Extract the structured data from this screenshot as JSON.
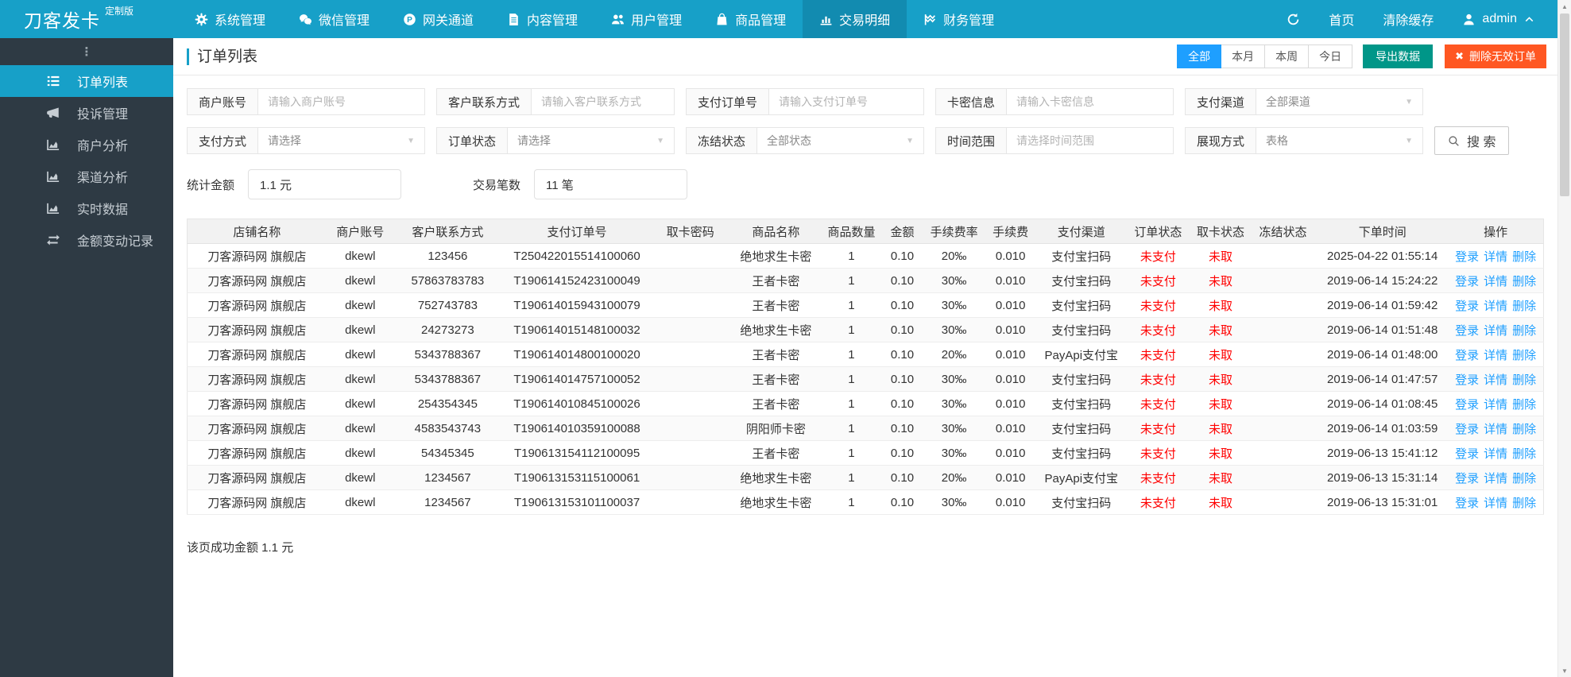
{
  "topbar": {
    "logo": "刀客发卡",
    "logo_badge": "定制版",
    "menu": [
      {
        "label": "系统管理",
        "icon": "gear-icon"
      },
      {
        "label": "微信管理",
        "icon": "wechat-icon"
      },
      {
        "label": "网关通道",
        "icon": "gateway-icon"
      },
      {
        "label": "内容管理",
        "icon": "content-icon"
      },
      {
        "label": "用户管理",
        "icon": "users-icon"
      },
      {
        "label": "商品管理",
        "icon": "goods-bag-icon"
      },
      {
        "label": "交易明细",
        "icon": "bar-chart-icon",
        "active": true
      },
      {
        "label": "财务管理",
        "icon": "finance-icon"
      }
    ],
    "right": {
      "home": "首页",
      "clear_cache": "清除缓存",
      "user": "admin"
    }
  },
  "sidebar": {
    "items": [
      {
        "label": "订单列表",
        "icon": "order-list-icon",
        "active": true
      },
      {
        "label": "投诉管理",
        "icon": "megaphone-icon"
      },
      {
        "label": "商户分析",
        "icon": "area-chart-icon"
      },
      {
        "label": "渠道分析",
        "icon": "area-chart-icon"
      },
      {
        "label": "实时数据",
        "icon": "area-chart-icon"
      },
      {
        "label": "金额变动记录",
        "icon": "exchange-icon"
      }
    ]
  },
  "page": {
    "title": "订单列表",
    "range_tabs": [
      "全部",
      "本月",
      "本周",
      "今日"
    ],
    "active_range_tab": "全部",
    "export_label": "导出数据",
    "delete_invalid_label": "删除无效订单"
  },
  "filters": {
    "row1": [
      {
        "label": "商户账号",
        "placeholder": "请输入商户账号",
        "type": "input"
      },
      {
        "label": "客户联系方式",
        "placeholder": "请输入客户联系方式",
        "type": "input"
      },
      {
        "label": "支付订单号",
        "placeholder": "请输入支付订单号",
        "type": "input"
      },
      {
        "label": "卡密信息",
        "placeholder": "请输入卡密信息",
        "type": "input"
      },
      {
        "label": "支付渠道",
        "value": "全部渠道",
        "type": "select"
      }
    ],
    "row2": [
      {
        "label": "支付方式",
        "value": "请选择",
        "type": "select"
      },
      {
        "label": "订单状态",
        "value": "请选择",
        "type": "select"
      },
      {
        "label": "冻结状态",
        "value": "全部状态",
        "type": "select"
      },
      {
        "label": "时间范围",
        "placeholder": "请选择时间范围",
        "type": "input"
      },
      {
        "label": "展现方式",
        "value": "表格",
        "type": "select"
      }
    ],
    "search_label": "搜 索",
    "stats": [
      {
        "label": "统计金额",
        "value": "1.1 元"
      },
      {
        "label": "交易笔数",
        "value": "11 笔"
      }
    ]
  },
  "table": {
    "columns": [
      "店铺名称",
      "商户账号",
      "客户联系方式",
      "支付订单号",
      "取卡密码",
      "商品名称",
      "商品数量",
      "金额",
      "手续费率",
      "手续费",
      "支付渠道",
      "订单状态",
      "取卡状态",
      "冻结状态",
      "下单时间",
      "操作"
    ],
    "actions": [
      "登录",
      "详情",
      "删除"
    ],
    "rows": [
      [
        "刀客源码网 旗舰店",
        "dkewl",
        "123456",
        "T250422015514100060",
        "",
        "绝地求生卡密",
        "1",
        "0.10",
        "20‰",
        "0.010",
        "支付宝扫码",
        "未支付",
        "未取",
        "",
        "2025-04-22 01:55:14"
      ],
      [
        "刀客源码网 旗舰店",
        "dkewl",
        "57863783783",
        "T190614152423100049",
        "",
        "王者卡密",
        "1",
        "0.10",
        "30‰",
        "0.010",
        "支付宝扫码",
        "未支付",
        "未取",
        "",
        "2019-06-14 15:24:22"
      ],
      [
        "刀客源码网 旗舰店",
        "dkewl",
        "752743783",
        "T190614015943100079",
        "",
        "王者卡密",
        "1",
        "0.10",
        "30‰",
        "0.010",
        "支付宝扫码",
        "未支付",
        "未取",
        "",
        "2019-06-14 01:59:42"
      ],
      [
        "刀客源码网 旗舰店",
        "dkewl",
        "24273273",
        "T190614015148100032",
        "",
        "绝地求生卡密",
        "1",
        "0.10",
        "30‰",
        "0.010",
        "支付宝扫码",
        "未支付",
        "未取",
        "",
        "2019-06-14 01:51:48"
      ],
      [
        "刀客源码网 旗舰店",
        "dkewl",
        "5343788367",
        "T190614014800100020",
        "",
        "王者卡密",
        "1",
        "0.10",
        "20‰",
        "0.010",
        "PayApi支付宝",
        "未支付",
        "未取",
        "",
        "2019-06-14 01:48:00"
      ],
      [
        "刀客源码网 旗舰店",
        "dkewl",
        "5343788367",
        "T190614014757100052",
        "",
        "王者卡密",
        "1",
        "0.10",
        "30‰",
        "0.010",
        "支付宝扫码",
        "未支付",
        "未取",
        "",
        "2019-06-14 01:47:57"
      ],
      [
        "刀客源码网 旗舰店",
        "dkewl",
        "254354345",
        "T190614010845100026",
        "",
        "王者卡密",
        "1",
        "0.10",
        "30‰",
        "0.010",
        "支付宝扫码",
        "未支付",
        "未取",
        "",
        "2019-06-14 01:08:45"
      ],
      [
        "刀客源码网 旗舰店",
        "dkewl",
        "4583543743",
        "T190614010359100088",
        "",
        "阴阳师卡密",
        "1",
        "0.10",
        "30‰",
        "0.010",
        "支付宝扫码",
        "未支付",
        "未取",
        "",
        "2019-06-14 01:03:59"
      ],
      [
        "刀客源码网 旗舰店",
        "dkewl",
        "54345345",
        "T190613154112100095",
        "",
        "王者卡密",
        "1",
        "0.10",
        "30‰",
        "0.010",
        "支付宝扫码",
        "未支付",
        "未取",
        "",
        "2019-06-13 15:41:12"
      ],
      [
        "刀客源码网 旗舰店",
        "dkewl",
        "1234567",
        "T190613153115100061",
        "",
        "绝地求生卡密",
        "1",
        "0.10",
        "20‰",
        "0.010",
        "PayApi支付宝",
        "未支付",
        "未取",
        "",
        "2019-06-13 15:31:14"
      ],
      [
        "刀客源码网 旗舰店",
        "dkewl",
        "1234567",
        "T190613153101100037",
        "",
        "绝地求生卡密",
        "1",
        "0.10",
        "30‰",
        "0.010",
        "支付宝扫码",
        "未支付",
        "未取",
        "",
        "2019-06-13 15:31:01"
      ]
    ]
  },
  "footer": {
    "summary": "该页成功金额 1.1 元"
  },
  "colors": {
    "topbar_bg": "#17a0c8",
    "topbar_active_bg": "#128bb0",
    "sidebar_bg": "#2e3a44",
    "primary_blue": "#1e9fff",
    "export_green": "#009688",
    "delete_orange": "#ff5722",
    "status_red": "#ff0000"
  }
}
